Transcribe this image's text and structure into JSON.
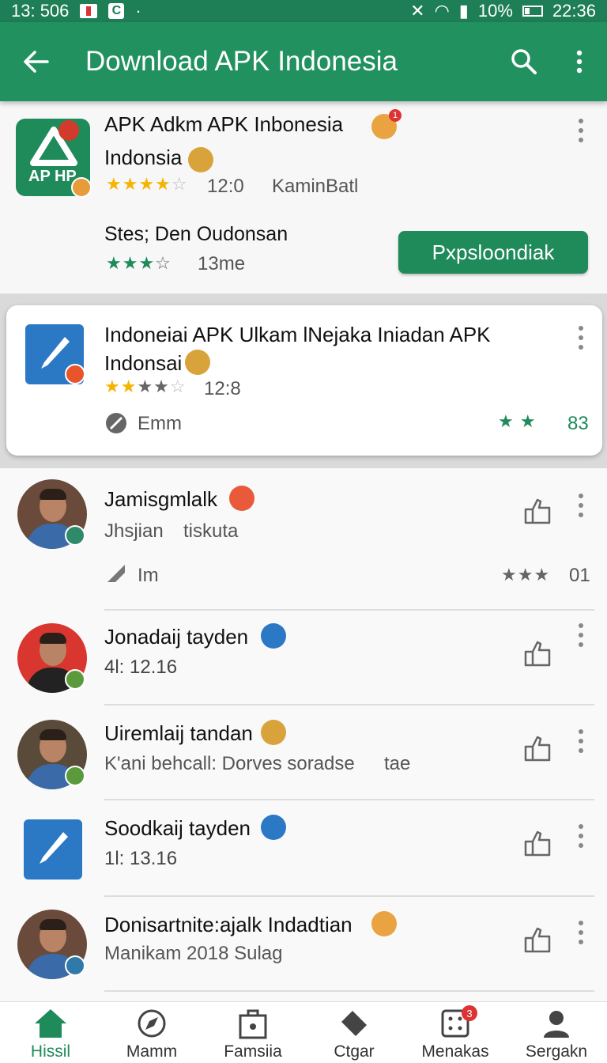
{
  "status_bar": {
    "time": "13: 506",
    "battery": "10%",
    "clock": "22:36"
  },
  "app_bar": {
    "title": "Download APK Indonesia"
  },
  "featured": {
    "title": "APK Adkm APK  Inbonesia",
    "title_line2": "Indonsia",
    "icon_label": "AP HP",
    "rating_text": "12:0",
    "meta": "KaminBatl",
    "developer": "Stes; Den Oudonsan",
    "dev_rating": "13me",
    "download_label": "Pxpsloondiak"
  },
  "highlight": {
    "title": "Indoneiai APK Ulkam lNejaka Iniadan APK",
    "title_line2": "Indonsai",
    "rating_text": "12:8",
    "meta": "Emm",
    "score": "83"
  },
  "items": [
    {
      "name": "Jamisgmlalk",
      "sub": "Jhsjian",
      "sub2": "tiskuta",
      "meta": "Im",
      "count": "01"
    },
    {
      "name": "Jonadaij tayden",
      "sub": "4l: 12.16"
    },
    {
      "name": "Uiremlaij tandan",
      "sub": "K'ani behcall: Dorves soradse",
      "sub2": "tae"
    },
    {
      "name": "Soodkaij tayden",
      "sub": "1l: 13.16"
    },
    {
      "name": "Donisartnite:ajalk Indadtian",
      "sub": "Manikam 2018 Sulag"
    }
  ],
  "bottom_nav": [
    {
      "label": "Hissil",
      "icon": "home-icon"
    },
    {
      "label": "Mamm",
      "icon": "compass-icon"
    },
    {
      "label": "Famsiia",
      "icon": "bag-icon"
    },
    {
      "label": "Ctgar",
      "icon": "tag-icon"
    },
    {
      "label": "Menakas",
      "icon": "grid-icon",
      "badge": "3"
    },
    {
      "label": "Sergakn",
      "icon": "person-icon"
    }
  ],
  "colors": {
    "primary": "#21915f",
    "accent_star": "#f4b400",
    "blue": "#2b78c5"
  }
}
